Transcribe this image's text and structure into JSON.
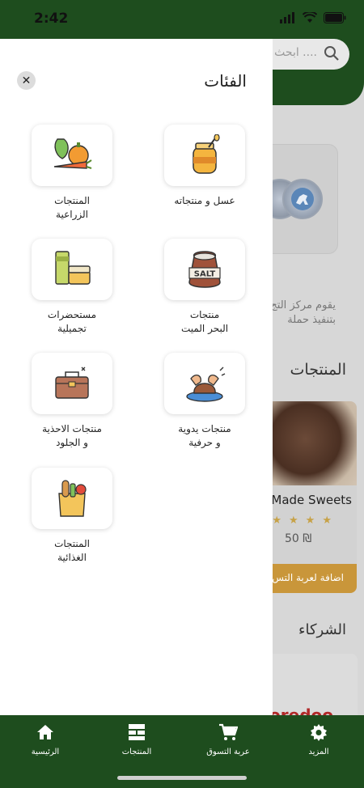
{
  "status_bar": {
    "time": "2:42"
  },
  "background": {
    "search_placeholder": "ابحث ....",
    "banner_text_line1": "يقوم مركز التج",
    "banner_text_line2": "بتنفيذ حملة",
    "products_heading": "المنتجات",
    "product_card": {
      "title": "e Made Sweets",
      "stars": "★★★★",
      "price": "50 ₪",
      "add_button": "اضافة لعربة التس"
    },
    "partners_heading": "الشركاء",
    "partner_logo": "ooredoo"
  },
  "drawer": {
    "title": "الفئات",
    "close_glyph": "✕",
    "categories": [
      {
        "label": "عسل و منتجاته",
        "icon": "honey-jar-icon"
      },
      {
        "label": "المنتجات\nالزراعية",
        "icon": "vegetables-icon"
      },
      {
        "label": "منتجات\nالبحر الميت",
        "icon": "salt-sack-icon"
      },
      {
        "label": "مستحضرات\nتجميلية",
        "icon": "cosmetics-icon"
      },
      {
        "label": "منتجات يدوية\nو حرفية",
        "icon": "pottery-hands-icon"
      },
      {
        "label": "منتجات الاحذية\nو الجلود",
        "icon": "leather-bag-icon"
      },
      {
        "label": "المنتجات\nالغذائية",
        "icon": "grocery-bag-icon"
      }
    ]
  },
  "bottom_nav": {
    "items": [
      {
        "label": "المزيد",
        "icon": "gear-icon"
      },
      {
        "label": "عربة التسوق",
        "icon": "cart-icon"
      },
      {
        "label": "المنتجات",
        "icon": "list-icon"
      },
      {
        "label": "الرئيسية",
        "icon": "home-icon"
      }
    ]
  },
  "colors": {
    "brand_green": "#1e4d1e",
    "accent_gold": "#c9963a"
  }
}
